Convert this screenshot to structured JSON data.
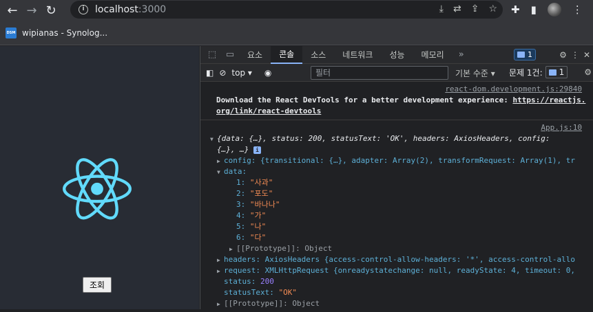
{
  "browser": {
    "url_host": "localhost",
    "url_port": ":3000"
  },
  "bookmarks": [
    {
      "icon": "DSM",
      "label": "wipianas - Synolog..."
    }
  ],
  "app": {
    "button_label": "조회",
    "logo_color": "#61dafb"
  },
  "devtools": {
    "tabs": [
      "요소",
      "콘솔",
      "소스",
      "네트워크",
      "성능",
      "메모리"
    ],
    "active_tab": "콘솔",
    "issues_badge": "1",
    "context": "top",
    "filter_placeholder": "필터",
    "level_label": "기본 수준",
    "issues_label": "문제 1건:",
    "issues_count": "1"
  },
  "console": {
    "message1": {
      "source": "react-dom.development.js:29840",
      "text_line1": "Download the React DevTools for a better development experience: ",
      "link_part1": "https://reactjs.",
      "link_part2": "org/link/react-devtools"
    },
    "message2": {
      "source": "App.js:10",
      "summary_line1": "{data: {…}, status: 200, statusText: 'OK', headers: AxiosHeaders, config:",
      "summary_line2": "{…}, …}",
      "config_line": "config: {transitional: {…}, adapter: Array(2), transformRequest: Array(1), tr",
      "data_label": "data:",
      "data_items": [
        {
          "index": "1:",
          "value": "\"사과\""
        },
        {
          "index": "2:",
          "value": "\"포도\""
        },
        {
          "index": "3:",
          "value": "\"바나나\""
        },
        {
          "index": "4:",
          "value": "\"가\""
        },
        {
          "index": "5:",
          "value": "\"나\""
        },
        {
          "index": "6:",
          "value": "\"다\""
        }
      ],
      "data_proto": "[[Prototype]]: Object",
      "headers_line": "headers: AxiosHeaders {access-control-allow-headers: '*', access-control-allo",
      "request_line": "request: XMLHttpRequest {onreadystatechange: null, readyState: 4, timeout: 0,",
      "status_key": "status:",
      "status_value": "200",
      "statusText_key": "statusText:",
      "statusText_value": "\"OK\"",
      "proto": "[[Prototype]]: Object"
    }
  }
}
